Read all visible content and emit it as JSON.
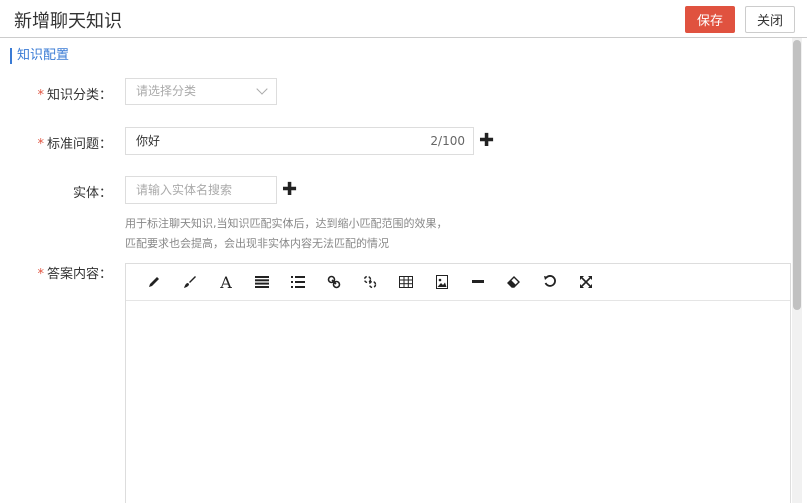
{
  "header": {
    "title": "新增聊天知识",
    "save_label": "保存",
    "close_label": "关闭"
  },
  "section": {
    "title": "知识配置"
  },
  "form": {
    "category": {
      "label": "知识分类：",
      "required": "*",
      "placeholder": "请选择分类"
    },
    "question": {
      "label": "标准问题：",
      "required": "*",
      "value": "你好",
      "counter": "2/100"
    },
    "entity": {
      "label": "实体：",
      "placeholder": "请输入实体名搜索",
      "hint_line1": "用于标注聊天知识,当知识匹配实体后，达到缩小匹配范围的效果，",
      "hint_line2": "匹配要求也会提高，会出现非实体内容无法匹配的情况"
    },
    "answer": {
      "label": "答案内容：",
      "required": "*"
    }
  },
  "editor": {
    "tools": [
      "pencil-icon",
      "brush-icon",
      "font-icon",
      "align-icon",
      "list-icon",
      "link-icon",
      "unlink-icon",
      "table-icon",
      "image-icon",
      "hr-icon",
      "eraser-icon",
      "undo-icon",
      "fullscreen-icon"
    ]
  }
}
